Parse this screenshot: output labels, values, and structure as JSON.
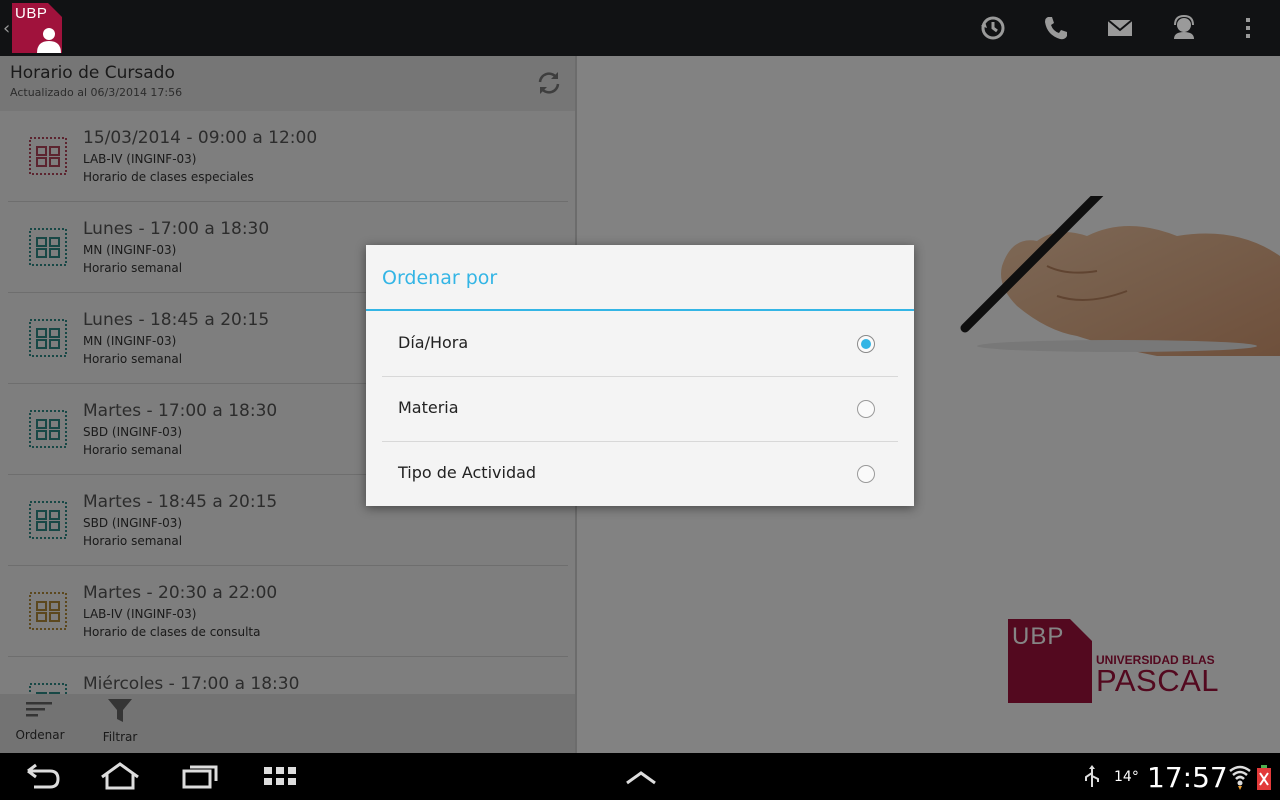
{
  "actionbar": {
    "logo_text": "UBP",
    "icons": [
      "history-icon",
      "phone-icon",
      "mail-icon",
      "contact-icon",
      "overflow-menu-icon"
    ]
  },
  "left_pane": {
    "title": "Horario de Cursado",
    "subtitle": "Actualizado al 06/3/2014 17:56",
    "items": [
      {
        "title": "15/03/2014 - 09:00 a 12:00",
        "subject": "LAB-IV (INGINF-03)",
        "type": "Horario de clases especiales",
        "icon_color": "#b0455a"
      },
      {
        "title": "Lunes - 17:00 a 18:30",
        "subject": "MN (INGINF-03)",
        "type": "Horario semanal",
        "icon_color": "#2f8a86"
      },
      {
        "title": "Lunes - 18:45 a 20:15",
        "subject": "MN (INGINF-03)",
        "type": "Horario semanal",
        "icon_color": "#2f8a86"
      },
      {
        "title": "Martes - 17:00 a 18:30",
        "subject": "SBD (INGINF-03)",
        "type": "Horario semanal",
        "icon_color": "#2f8a86"
      },
      {
        "title": "Martes - 18:45 a 20:15",
        "subject": "SBD (INGINF-03)",
        "type": "Horario semanal",
        "icon_color": "#2f8a86"
      },
      {
        "title": "Martes - 20:30 a 22:00",
        "subject": "LAB-IV (INGINF-03)",
        "type": "Horario de clases de consulta",
        "icon_color": "#b08a3a"
      },
      {
        "title": "Miércoles - 17:00 a 18:30",
        "subject": "",
        "type": "",
        "icon_color": "#2f8a86"
      }
    ],
    "bottom_bar": {
      "sort_label": "Ordenar",
      "filter_label": "Filtrar"
    }
  },
  "right_pane": {
    "brand_block": "UBP",
    "brand_line1": "UNIVERSIDAD BLAS",
    "brand_line2": "PASCAL"
  },
  "dialog": {
    "title": "Ordenar por",
    "options": [
      {
        "label": "Día/Hora",
        "checked": true
      },
      {
        "label": "Materia",
        "checked": false
      },
      {
        "label": "Tipo de Actividad",
        "checked": false
      }
    ]
  },
  "statusbar": {
    "temperature": "14°",
    "time": "17:57"
  },
  "colors": {
    "accent": "#33b5e5",
    "brand": "#a0123c"
  }
}
